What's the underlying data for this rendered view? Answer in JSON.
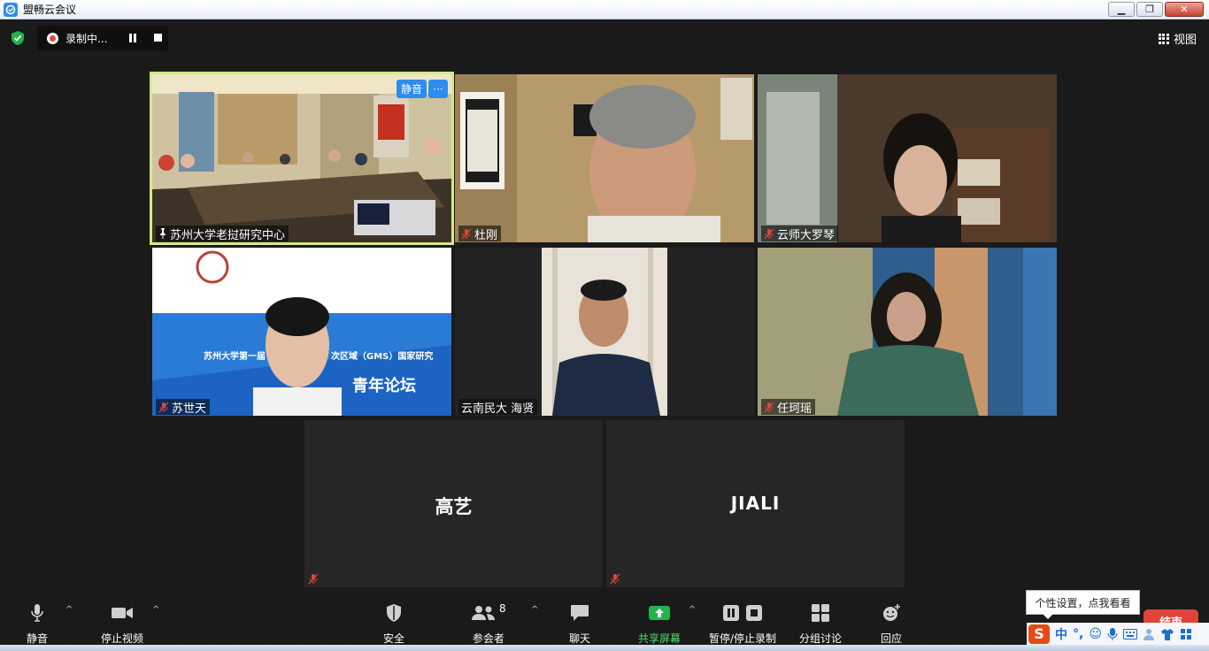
{
  "window": {
    "title": "盟畅云会议",
    "buttons": [
      "minimize",
      "restore",
      "close"
    ]
  },
  "topbar": {
    "recording_label": "录制中...",
    "view_label": "视图"
  },
  "tiles": {
    "t1": {
      "name": "苏州大学老挝研究中心",
      "mute_btn": "静音",
      "more_btn": "···"
    },
    "t2": {
      "name": "杜刚"
    },
    "t3": {
      "name": "云师大罗琴"
    },
    "t4": {
      "name": "苏世天",
      "slide_line1": "苏州大学第一届",
      "slide_line2": "次区域（GMS）国家研究",
      "slide_line3": "青年论坛"
    },
    "t5": {
      "name": "云南民大 海贤"
    },
    "t6": {
      "name": "任珂瑶"
    },
    "t7": {
      "avatar_name": "高艺"
    },
    "t8": {
      "avatar_name": "JIALI"
    }
  },
  "toolbar": {
    "mute": "静音",
    "stop_video": "停止视频",
    "security": "安全",
    "participants": "参会者",
    "participant_count": "8",
    "chat": "聊天",
    "share": "共享屏幕",
    "pause_record": "暂停/停止录制",
    "breakout": "分组讨论",
    "reactions": "回应",
    "end": "结束"
  },
  "tooltip": "个性设置，点我看看",
  "ime": {
    "lang": "中"
  },
  "colors": {
    "accent": "#2d8cf0",
    "active_border": "#d5e98a",
    "end": "#e0433a",
    "share": "#4fe06b",
    "mute": "#e0433a"
  }
}
